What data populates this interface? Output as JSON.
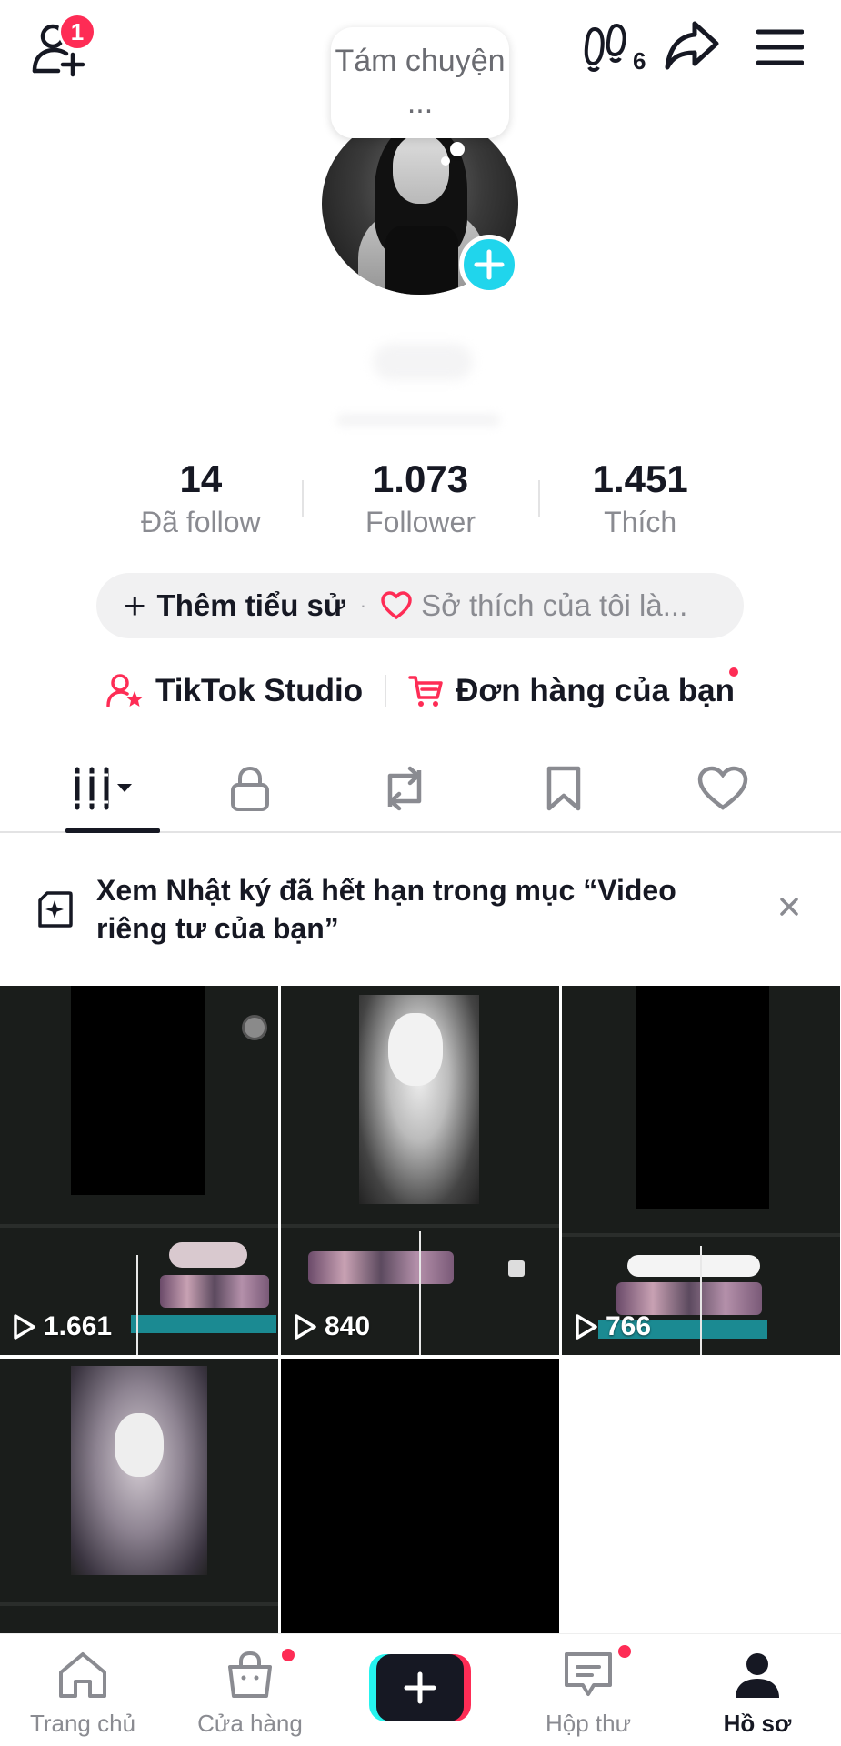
{
  "header": {
    "notification_count": "1",
    "profile_views_count": "6"
  },
  "profile": {
    "note": "Tám chuyện ...",
    "stats": [
      {
        "value": "14",
        "label": "Đã follow"
      },
      {
        "value": "1.073",
        "label": "Follower"
      },
      {
        "value": "1.451",
        "label": "Thích"
      }
    ],
    "bio_add_label": "Thêm tiểu sử",
    "bio_separator": "·",
    "bio_interest_placeholder": "Sở thích của tôi là...",
    "studio_label": "TikTok Studio",
    "orders_label": "Đơn hàng của bạn"
  },
  "tabs": [
    {
      "icon": "grid-icon",
      "active": true
    },
    {
      "icon": "lock-icon",
      "active": false
    },
    {
      "icon": "repost-icon",
      "active": false
    },
    {
      "icon": "bookmark-icon",
      "active": false
    },
    {
      "icon": "heart-icon",
      "active": false
    }
  ],
  "banner": {
    "text": "Xem Nhật ký đã hết hạn trong mục “Video riêng tư của bạn”"
  },
  "videos": [
    {
      "plays": "1.661"
    },
    {
      "plays": "840"
    },
    {
      "plays": "766"
    },
    {
      "plays": ""
    },
    {
      "plays": ""
    }
  ],
  "bottom_nav": {
    "home": "Trang chủ",
    "shop": "Cửa hàng",
    "inbox": "Hộp thư",
    "profile": "Hồ sơ"
  },
  "colors": {
    "accent_red": "#fe2c55",
    "accent_cyan": "#25f4ee",
    "avatar_add": "#20d5ec",
    "text_primary": "#161823",
    "text_secondary": "#8a8b91"
  }
}
